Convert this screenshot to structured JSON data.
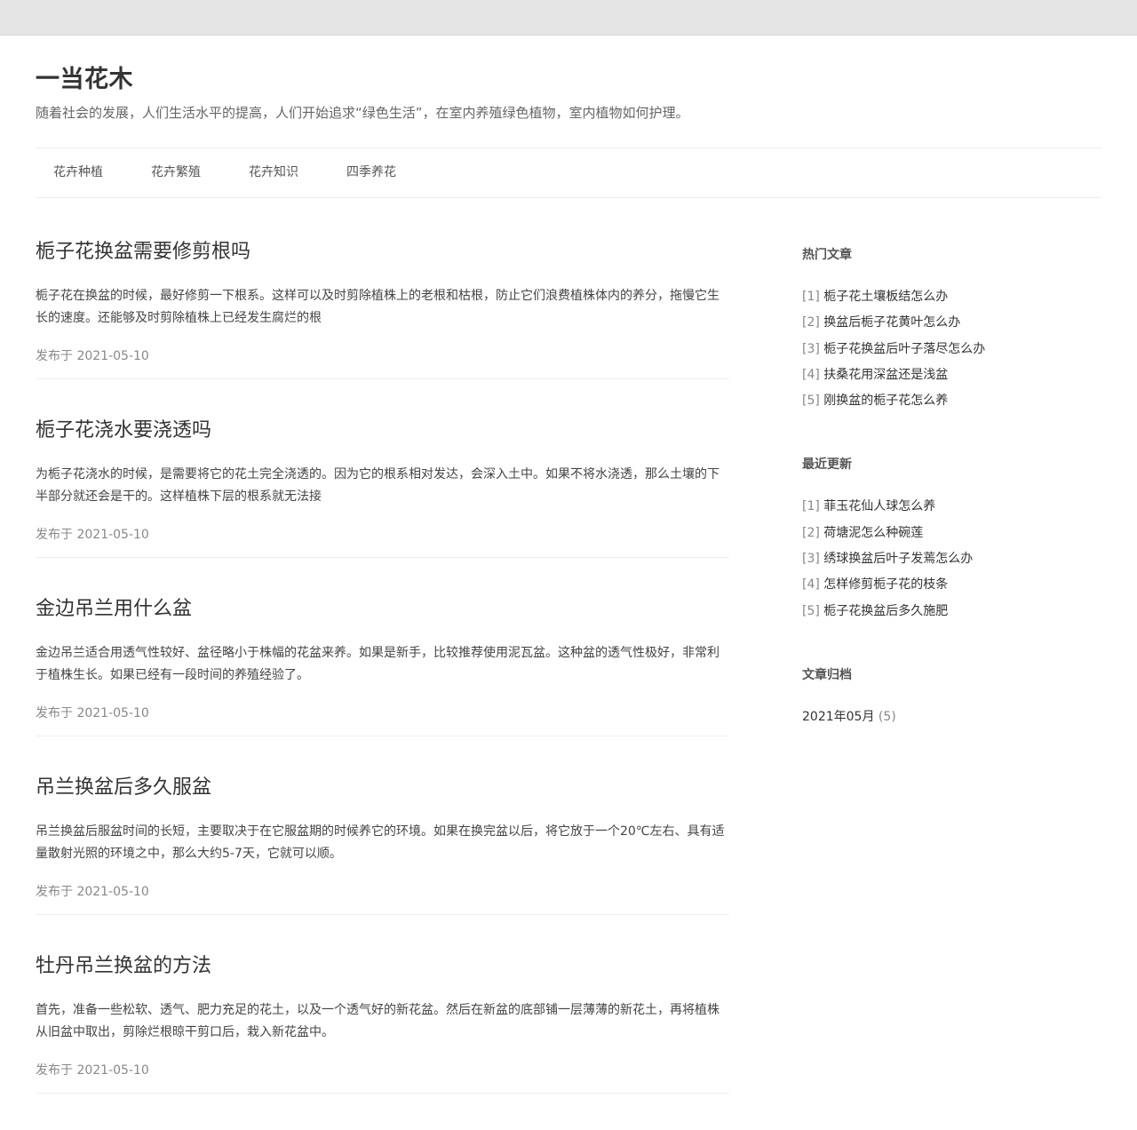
{
  "site": {
    "title": "一当花木",
    "description": "随着社会的发展，人们生活水平的提高，人们开始追求“绿色生活”，在室内养殖绿色植物，室内植物如何护理。"
  },
  "nav": {
    "items": [
      "花卉种植",
      "花卉繁殖",
      "花卉知识",
      "四季养花"
    ]
  },
  "posts": [
    {
      "title": "栀子花换盆需要修剪根吗",
      "excerpt": "栀子花在换盆的时候，最好修剪一下根系。这样可以及时剪除植株上的老根和枯根，防止它们浪费植株体内的养分，拖慢它生长的速度。还能够及时剪除植株上已经发生腐烂的根",
      "meta": "发布于 2021-05-10"
    },
    {
      "title": "栀子花浇水要浇透吗",
      "excerpt": "为栀子花浇水的时候，是需要将它的花土完全浇透的。因为它的根系相对发达，会深入土中。如果不将水浇透，那么土壤的下半部分就还会是干的。这样植株下层的根系就无法接",
      "meta": "发布于 2021-05-10"
    },
    {
      "title": "金边吊兰用什么盆",
      "excerpt": "金边吊兰适合用透气性较好、盆径略小于株幅的花盆来养。如果是新手，比较推荐使用泥瓦盆。这种盆的透气性极好，非常利于植株生长。如果已经有一段时间的养殖经验了。",
      "meta": "发布于 2021-05-10"
    },
    {
      "title": "吊兰换盆后多久服盆",
      "excerpt": "吊兰换盆后服盆时间的长短，主要取决于在它服盆期的时候养它的环境。如果在换完盆以后，将它放于一个20℃左右、具有适量散射光照的环境之中，那么大约5-7天，它就可以顺。",
      "meta": "发布于 2021-05-10"
    },
    {
      "title": "牡丹吊兰换盆的方法",
      "excerpt": "首先，准备一些松软、透气、肥力充足的花土，以及一个透气好的新花盆。然后在新盆的底部铺一层薄薄的新花土，再将植株从旧盆中取出，剪除烂根晾干剪口后，栽入新花盆中。",
      "meta": "发布于 2021-05-10"
    }
  ],
  "sidebar": {
    "hot": {
      "title": "热门文章",
      "items": [
        {
          "index": "[1]",
          "label": "栀子花土壤板结怎么办"
        },
        {
          "index": "[2]",
          "label": "换盆后栀子花黄叶怎么办"
        },
        {
          "index": "[3]",
          "label": "栀子花换盆后叶子落尽怎么办"
        },
        {
          "index": "[4]",
          "label": "扶桑花用深盆还是浅盆"
        },
        {
          "index": "[5]",
          "label": "刚换盆的栀子花怎么养"
        }
      ]
    },
    "recent": {
      "title": "最近更新",
      "items": [
        {
          "index": "[1]",
          "label": "菲玉花仙人球怎么养"
        },
        {
          "index": "[2]",
          "label": "荷塘泥怎么种碗莲"
        },
        {
          "index": "[3]",
          "label": "绣球换盆后叶子发蔫怎么办"
        },
        {
          "index": "[4]",
          "label": "怎样修剪栀子花的枝条"
        },
        {
          "index": "[5]",
          "label": "栀子花换盆后多久施肥"
        }
      ]
    },
    "archive": {
      "title": "文章归档",
      "items": [
        {
          "label": "2021年05月",
          "count": "(5)"
        }
      ]
    }
  }
}
